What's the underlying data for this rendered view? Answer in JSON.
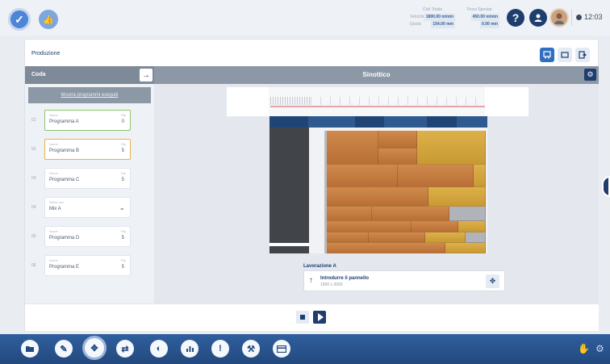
{
  "topbar": {
    "stats_a": {
      "head": "Cicli Totale",
      "rows": [
        {
          "label": "Velocità",
          "value": "1800.00 m/min"
        },
        {
          "label": "Quota",
          "value": "154.00 mm"
        }
      ]
    },
    "stats_b": {
      "head": "Pezzi Spostat",
      "rows": [
        {
          "value": "450.00 m/min"
        },
        {
          "value": "0.00 mm"
        }
      ]
    },
    "help_icon": "?",
    "time": "12:03"
  },
  "panel": {
    "breadcrumb": "Produzione"
  },
  "queue": {
    "title": "Coda",
    "show_executed": "Mostra programmi eseguiti",
    "items": [
      {
        "num": "01",
        "label": "Nome",
        "name": "Programma A",
        "rlabel": "Rip",
        "rval": "0",
        "state": "green"
      },
      {
        "num": "02",
        "label": "Nome",
        "name": "Programma B",
        "rlabel": "Rip",
        "rval": "5",
        "state": "orange"
      },
      {
        "num": "03",
        "label": "Nome",
        "name": "Programma C",
        "rlabel": "Rip",
        "rval": "5",
        "state": ""
      },
      {
        "num": "04",
        "label": "Nome mix",
        "name": "Mix A",
        "rlabel": "",
        "rval": "",
        "state": "",
        "expandable": true
      },
      {
        "num": "05",
        "label": "Nome",
        "name": "Programma D",
        "rlabel": "Rip",
        "rval": "5",
        "state": ""
      },
      {
        "num": "06",
        "label": "Nome",
        "name": "Programma E",
        "rlabel": "Rip",
        "rval": "5",
        "state": ""
      }
    ]
  },
  "sinottico": {
    "title": "Sinottico",
    "lavorazione_title": "Lavorazione A",
    "instruction": "Introdurre il pannello",
    "dimensions": "1500 x 3000"
  },
  "colors": {
    "accent": "#1f3d6e",
    "wood": "#c47d40",
    "gold": "#d4a83f",
    "green": "#8cc56f",
    "orange": "#e7b24a"
  }
}
